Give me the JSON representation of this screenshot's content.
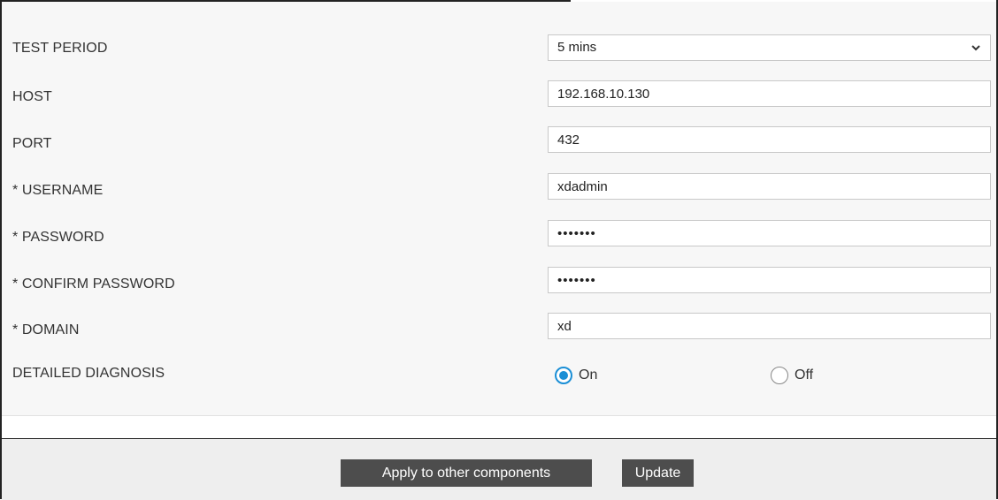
{
  "form": {
    "test_period": {
      "label": "TEST PERIOD",
      "value": "5 mins"
    },
    "host": {
      "label": "HOST",
      "value": "192.168.10.130"
    },
    "port": {
      "label": "PORT",
      "value": "432"
    },
    "username": {
      "label": "* USERNAME",
      "value": "xdadmin"
    },
    "password": {
      "label": "* PASSWORD",
      "value": "•••••••"
    },
    "confirm_password": {
      "label": "* CONFIRM PASSWORD",
      "value": "•••••••"
    },
    "domain": {
      "label": "* DOMAIN",
      "value": "xd"
    },
    "detailed_diagnosis": {
      "label": "DETAILED DIAGNOSIS",
      "options": [
        {
          "label": "On",
          "checked": true
        },
        {
          "label": "Off",
          "checked": false
        }
      ]
    }
  },
  "buttons": {
    "apply_label": "Apply to other components",
    "update_label": "Update"
  },
  "colors": {
    "accent": "#1b8fd6",
    "button_bg": "#4d4d4d",
    "panel_bg": "#f7f7f7",
    "footer_bg": "#eeeeee"
  },
  "icons": {
    "select_toggle": "chevron-down-icon"
  }
}
